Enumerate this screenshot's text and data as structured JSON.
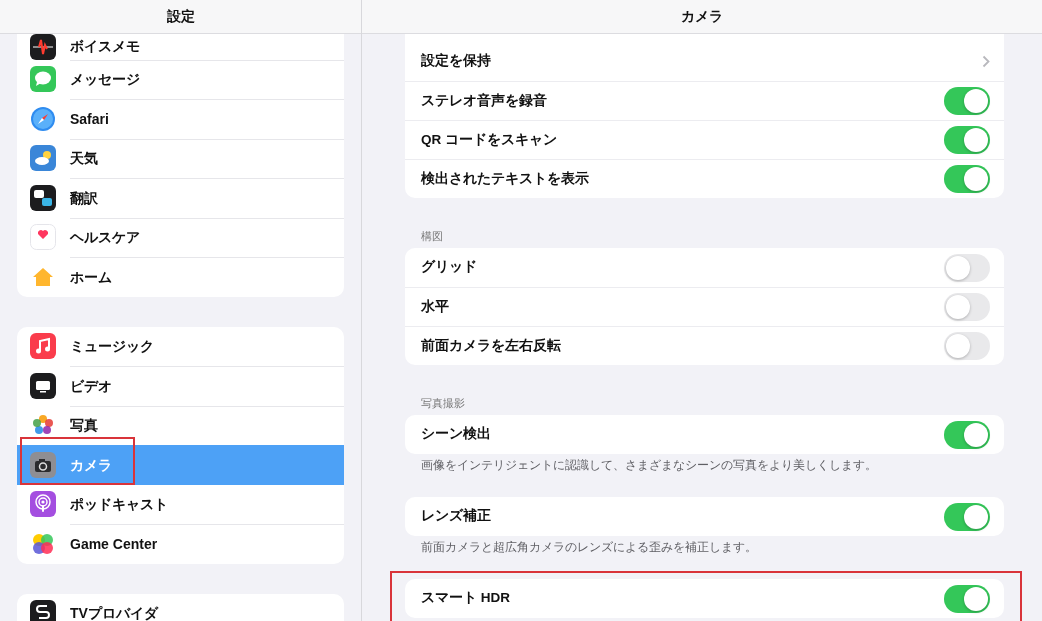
{
  "sidebar": {
    "title": "設定",
    "groups": [
      {
        "items": [
          {
            "label": "ボイスメモ",
            "selected": false,
            "highlighted": false
          },
          {
            "label": "メッセージ",
            "selected": false,
            "highlighted": false
          },
          {
            "label": "Safari",
            "selected": false,
            "highlighted": false
          },
          {
            "label": "天気",
            "selected": false,
            "highlighted": false
          },
          {
            "label": "翻訳",
            "selected": false,
            "highlighted": false
          },
          {
            "label": "ヘルスケア",
            "selected": false,
            "highlighted": false
          },
          {
            "label": "ホーム",
            "selected": false,
            "highlighted": false
          }
        ]
      },
      {
        "items": [
          {
            "label": "ミュージック",
            "selected": false,
            "highlighted": false
          },
          {
            "label": "ビデオ",
            "selected": false,
            "highlighted": false
          },
          {
            "label": "写真",
            "selected": false,
            "highlighted": false
          },
          {
            "label": "カメラ",
            "selected": true,
            "highlighted": true
          },
          {
            "label": "ポッドキャスト",
            "selected": false,
            "highlighted": false
          },
          {
            "label": "Game Center",
            "selected": false,
            "highlighted": false
          }
        ]
      },
      {
        "items": [
          {
            "label": "TVプロバイダ",
            "selected": false,
            "highlighted": false
          }
        ]
      }
    ]
  },
  "detail": {
    "title": "カメラ",
    "sections": [
      {
        "highlighted": false,
        "rows": [
          {
            "label": "設定を保持",
            "kind": "chevron"
          },
          {
            "label": "ステレオ音声を録音",
            "kind": "toggle",
            "on": true
          },
          {
            "label": "QR コードをスキャン",
            "kind": "toggle",
            "on": true
          },
          {
            "label": "検出されたテキストを表示",
            "kind": "toggle",
            "on": true
          }
        ]
      },
      {
        "header": "構図",
        "highlighted": false,
        "rows": [
          {
            "label": "グリッド",
            "kind": "toggle",
            "on": false
          },
          {
            "label": "水平",
            "kind": "toggle",
            "on": false
          },
          {
            "label": "前面カメラを左右反転",
            "kind": "toggle",
            "on": false
          }
        ]
      },
      {
        "header": "写真撮影",
        "highlighted": false,
        "rows": [
          {
            "label": "シーン検出",
            "kind": "toggle",
            "on": true
          }
        ],
        "footer": "画像をインテリジェントに認識して、さまざまなシーンの写真をより美しくします。"
      },
      {
        "highlighted": false,
        "rows": [
          {
            "label": "レンズ補正",
            "kind": "toggle",
            "on": true
          }
        ],
        "footer": "前面カメラと超広角カメラのレンズによる歪みを補正します。"
      },
      {
        "highlighted": true,
        "rows": [
          {
            "label": "スマート HDR",
            "kind": "toggle",
            "on": true
          }
        ]
      }
    ]
  }
}
